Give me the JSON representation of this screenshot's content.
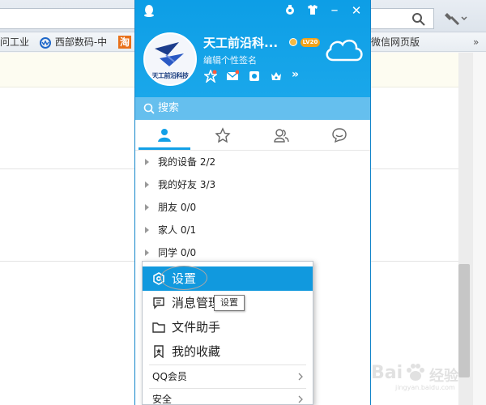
{
  "browser": {
    "bookmarks": [
      {
        "label": "问工业"
      },
      {
        "label": "西部数码-中"
      },
      {
        "label": "淘"
      },
      {
        "label": "微信网页版"
      }
    ]
  },
  "qq": {
    "nickname": "天工前沿科...",
    "level_badge": "LV20",
    "signature": "编辑个性签名",
    "avatar_text": "天工前沿科技",
    "search_placeholder": "搜索",
    "groups": [
      {
        "label": "我的设备 2/2"
      },
      {
        "label": "我的好友 3/3"
      },
      {
        "label": "朋友 0/0"
      },
      {
        "label": "家人 0/1"
      },
      {
        "label": "同学 0/0"
      }
    ],
    "menu": {
      "settings": "设置",
      "message_manager": "消息管理",
      "file_assistant": "文件助手",
      "favorites": "我的收藏",
      "qq_vip": "QQ会员",
      "security": "安全"
    },
    "tooltip": "设置"
  },
  "watermark": {
    "brand": "Bai",
    "brand_cn": "经验",
    "url": "jingyan.baidu.com"
  },
  "colors": {
    "header_blue": "#0d9ee6",
    "search_blue": "#65bfee",
    "menu_active": "#1199de"
  },
  "icons": [
    "search-icon",
    "wrench-icon",
    "qq-penguin-icon",
    "shirt-icon",
    "close-icon",
    "cloud-icon",
    "contacts-icon",
    "star-icon",
    "group-icon",
    "chat-icon",
    "settings-hex-icon",
    "message-icon",
    "folder-icon",
    "bookmark-icon"
  ]
}
